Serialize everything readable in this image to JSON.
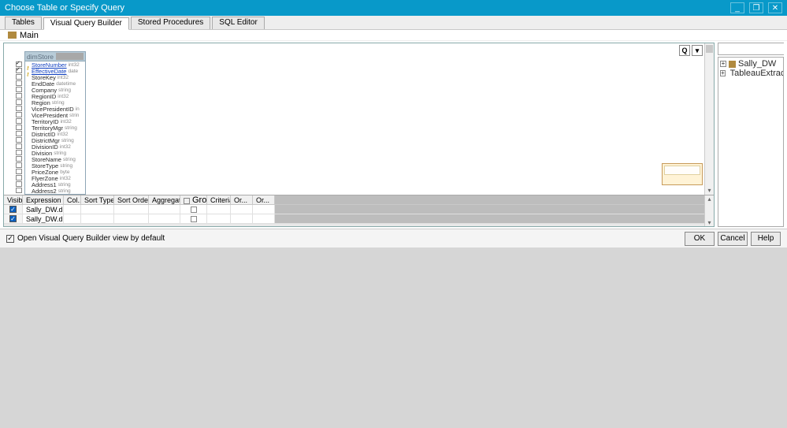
{
  "window": {
    "title": "Choose Table or Specify Query"
  },
  "tabs": [
    "Tables",
    "Visual Query Builder",
    "Stored Procedures",
    "SQL Editor"
  ],
  "active_tab": 1,
  "breadcrumb": {
    "label": "Main"
  },
  "table_card": {
    "title": "dimStore (Sally_D...",
    "fields": [
      {
        "checked": true,
        "key": true,
        "name": "StoreNumber",
        "type": "int32",
        "link": true
      },
      {
        "checked": true,
        "key": true,
        "name": "EffectiveDate",
        "type": "date",
        "link": true
      },
      {
        "checked": false,
        "key": false,
        "name": "StoreKey",
        "type": "int32"
      },
      {
        "checked": false,
        "key": false,
        "name": "EndDate",
        "type": "datetime"
      },
      {
        "checked": false,
        "key": false,
        "name": "Company",
        "type": "string"
      },
      {
        "checked": false,
        "key": false,
        "name": "RegionID",
        "type": "int32"
      },
      {
        "checked": false,
        "key": false,
        "name": "Region",
        "type": "string"
      },
      {
        "checked": false,
        "key": false,
        "name": "VicePresidentID",
        "type": "in"
      },
      {
        "checked": false,
        "key": false,
        "name": "VicePresident",
        "type": "strin"
      },
      {
        "checked": false,
        "key": false,
        "name": "TerritoryID",
        "type": "int32"
      },
      {
        "checked": false,
        "key": false,
        "name": "TerritoryMgr",
        "type": "string"
      },
      {
        "checked": false,
        "key": false,
        "name": "DistrictID",
        "type": "int32"
      },
      {
        "checked": false,
        "key": false,
        "name": "DistrictMgr",
        "type": "string"
      },
      {
        "checked": false,
        "key": false,
        "name": "DivisionID",
        "type": "int32"
      },
      {
        "checked": false,
        "key": false,
        "name": "Division",
        "type": "string"
      },
      {
        "checked": false,
        "key": false,
        "name": "StoreName",
        "type": "string"
      },
      {
        "checked": false,
        "key": false,
        "name": "StoreType",
        "type": "string"
      },
      {
        "checked": false,
        "key": false,
        "name": "PriceZone",
        "type": "byte"
      },
      {
        "checked": false,
        "key": false,
        "name": "FlyerZone",
        "type": "int32"
      },
      {
        "checked": false,
        "key": false,
        "name": "Address1",
        "type": "string"
      },
      {
        "checked": false,
        "key": false,
        "name": "Address2",
        "type": "string"
      }
    ]
  },
  "canvas_tool": {
    "search": "Q"
  },
  "grid": {
    "headers": {
      "visible": "Visible",
      "expression": "Expression",
      "col": "Col...",
      "sort_type": "Sort Type",
      "sort_order": "Sort Order",
      "aggregate": "Aggregate",
      "grouping": "Grouping",
      "criteria": "Criteria",
      "or": "Or..."
    },
    "rows": [
      {
        "visible": true,
        "expression": "Sally_DW.dbo.di..."
      },
      {
        "visible": true,
        "expression": "Sally_DW.dbo.di..."
      }
    ]
  },
  "tree": {
    "items": [
      {
        "label": "Sally_DW"
      },
      {
        "label": "TableauExtracts"
      }
    ]
  },
  "footer": {
    "default_label": "Open Visual Query Builder view by default",
    "ok": "OK",
    "cancel": "Cancel",
    "help": "Help"
  }
}
